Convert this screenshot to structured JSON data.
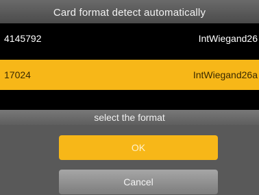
{
  "title": "Card format detect automatically",
  "list": {
    "items": [
      {
        "number": "4145792",
        "format": "IntWiegand26"
      },
      {
        "number": "17024",
        "format": "IntWiegand26a"
      }
    ]
  },
  "dialog": {
    "header": "select the format",
    "ok_label": "OK",
    "cancel_label": "Cancel"
  },
  "colors": {
    "accent": "#f7b718",
    "background": "#000000",
    "title_bar": "#5a5a5a"
  }
}
